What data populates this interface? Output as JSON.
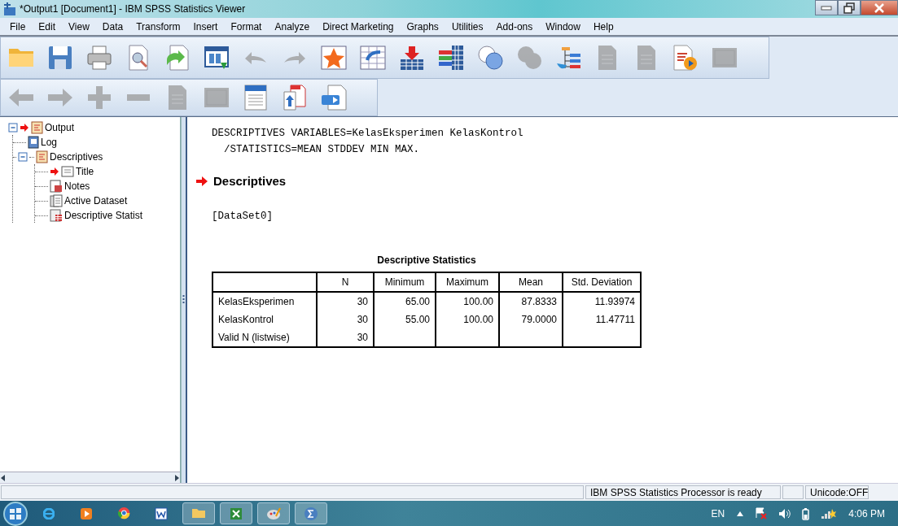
{
  "window": {
    "title": "*Output1 [Document1] - IBM SPSS Statistics Viewer"
  },
  "menu": [
    "File",
    "Edit",
    "View",
    "Data",
    "Transform",
    "Insert",
    "Format",
    "Analyze",
    "Direct Marketing",
    "Graphs",
    "Utilities",
    "Add-ons",
    "Window",
    "Help"
  ],
  "toolbar_main": [
    {
      "kind": "folder",
      "disabled": false
    },
    {
      "kind": "save",
      "disabled": false
    },
    {
      "kind": "print",
      "disabled": false
    },
    {
      "kind": "preview",
      "disabled": false
    },
    {
      "kind": "export",
      "disabled": false
    },
    {
      "kind": "recall",
      "disabled": false
    },
    {
      "kind": "undo",
      "disabled": true
    },
    {
      "kind": "redo",
      "disabled": true
    },
    {
      "kind": "star",
      "disabled": false
    },
    {
      "kind": "gridarrow",
      "disabled": false
    },
    {
      "kind": "insert",
      "disabled": false
    },
    {
      "kind": "bars",
      "disabled": false
    },
    {
      "kind": "venn",
      "disabled": false
    },
    {
      "kind": "venn",
      "disabled": true
    },
    {
      "kind": "tree",
      "disabled": false
    },
    {
      "kind": "doc",
      "disabled": true
    },
    {
      "kind": "doc",
      "disabled": true
    },
    {
      "kind": "play",
      "disabled": false
    },
    {
      "kind": "frame",
      "disabled": true
    }
  ],
  "toolbar_outline": [
    {
      "kind": "left",
      "disabled": true
    },
    {
      "kind": "right",
      "disabled": true
    },
    {
      "kind": "plus",
      "disabled": true
    },
    {
      "kind": "minus",
      "disabled": true
    },
    {
      "kind": "doc",
      "disabled": true
    },
    {
      "kind": "frame",
      "disabled": true
    },
    {
      "kind": "lines",
      "disabled": false
    },
    {
      "kind": "docs",
      "disabled": false
    },
    {
      "kind": "swap",
      "disabled": false
    }
  ],
  "outline": [
    {
      "label": "Output",
      "kind": "folder",
      "arrow": true,
      "expanded": true,
      "children": [
        {
          "label": "Log",
          "kind": "log",
          "arrow": false
        },
        {
          "label": "Descriptives",
          "kind": "folder",
          "arrow": false,
          "expanded": true,
          "children": [
            {
              "label": "Title",
              "kind": "title",
              "arrow": true
            },
            {
              "label": "Notes",
              "kind": "notes",
              "arrow": false
            },
            {
              "label": "Active Dataset",
              "kind": "page",
              "arrow": false
            },
            {
              "label": "Descriptive Statist",
              "kind": "table",
              "arrow": false
            }
          ]
        }
      ]
    }
  ],
  "output": {
    "syntax": [
      "DESCRIPTIVES VARIABLES=KelasEksperimen KelasKontrol",
      "  /STATISTICS=MEAN STDDEV MIN MAX."
    ],
    "heading": "Descriptives",
    "dataset": "[DataSet0]",
    "table": {
      "title": "Descriptive Statistics",
      "columns": [
        "",
        "N",
        "Minimum",
        "Maximum",
        "Mean",
        "Std. Deviation"
      ],
      "rows": [
        [
          "KelasEksperimen",
          "30",
          "65.00",
          "100.00",
          "87.8333",
          "11.93974"
        ],
        [
          "KelasKontrol",
          "30",
          "55.00",
          "100.00",
          "79.0000",
          "11.47711"
        ],
        [
          "Valid N (listwise)",
          "30",
          "",
          "",
          "",
          ""
        ]
      ]
    }
  },
  "status_bar": [
    {
      "kind": "empty"
    },
    {
      "kind": "text",
      "text": "IBM SPSS Statistics Processor is ready"
    },
    {
      "kind": "empty"
    },
    {
      "kind": "text",
      "text": "Unicode:OFF"
    }
  ],
  "taskbar": {
    "apps": [
      {
        "kind": "ie",
        "open": false
      },
      {
        "kind": "media",
        "open": false
      },
      {
        "kind": "chrome",
        "open": false
      },
      {
        "kind": "word",
        "open": false
      },
      {
        "kind": "explorer",
        "open": true
      },
      {
        "kind": "excel",
        "open": true
      },
      {
        "kind": "paint",
        "open": true
      },
      {
        "kind": "sigma",
        "open": true
      }
    ],
    "language": "EN",
    "clock": "4:06 PM"
  }
}
